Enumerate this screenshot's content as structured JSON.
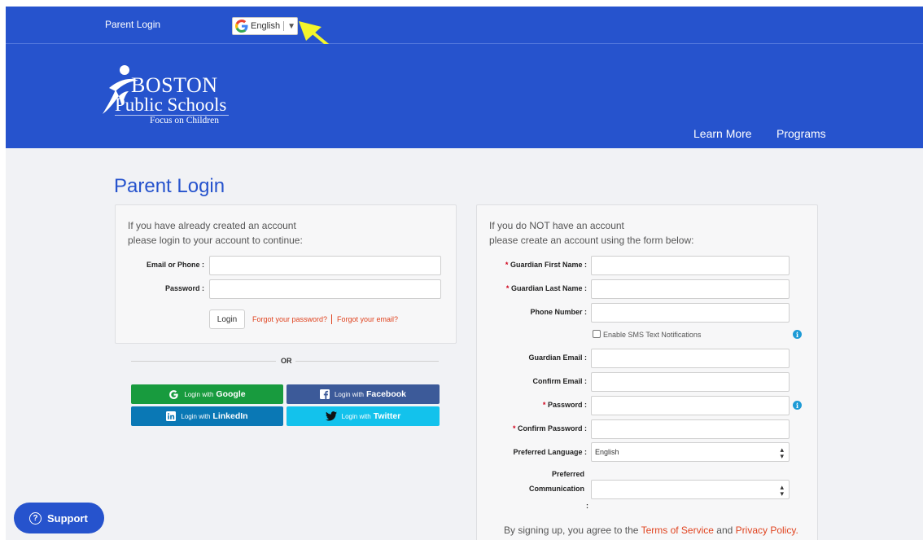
{
  "header": {
    "parent_login": "Parent Login",
    "language": "English",
    "language_caret": "▼"
  },
  "logo": {
    "line1": "BOSTON",
    "line2": "Public Schools",
    "tagline": "Focus on Children"
  },
  "nav": {
    "learn_more": "Learn More",
    "programs": "Programs"
  },
  "page_title": "Parent Login",
  "login_card": {
    "intro1": "If you have already created an account",
    "intro2": "please login to your account to continue:",
    "email_label": "Email or Phone",
    "password_label": "Password",
    "login_button": "Login",
    "forgot_password": "Forgot your password?",
    "forgot_email": "Forgot your email?"
  },
  "or_text": "OR",
  "social": {
    "google_pre": "Login with",
    "google": "Google",
    "facebook_pre": "Login with",
    "facebook": "Facebook",
    "linkedin_pre": "Login with",
    "linkedin": "LinkedIn",
    "twitter_pre": "Login with",
    "twitter": "Twitter"
  },
  "signup_card": {
    "intro1": "If you do NOT have an account",
    "intro2": "please create an account using the form below:",
    "required_mark": "*",
    "colon": ":",
    "first_name": "Guardian First Name",
    "last_name": "Guardian Last Name",
    "phone": "Phone Number",
    "sms": "Enable SMS Text Notifications",
    "guardian_email": "Guardian Email",
    "confirm_email": "Confirm Email",
    "password": "Password",
    "confirm_password": "Confirm Password",
    "preferred_language": "Preferred Language",
    "preferred_language_value": "English",
    "preferred_comm_1": "Preferred",
    "preferred_comm_2": "Communication",
    "preferred_comm_value": "",
    "terms_pre": "By signing up, you agree to the",
    "terms_link": "Terms of Service",
    "terms_and": "and",
    "privacy_link": "Privacy Policy",
    "terms_end": "."
  },
  "support": "Support",
  "colors": {
    "brand_blue": "#2653cd",
    "google_green": "#189b3e",
    "facebook": "#3c5a99",
    "linkedin": "#0a78b5",
    "twitter": "#13c2ec",
    "link_red": "#e0431f",
    "annotation_arrow": "#f3f52a"
  }
}
